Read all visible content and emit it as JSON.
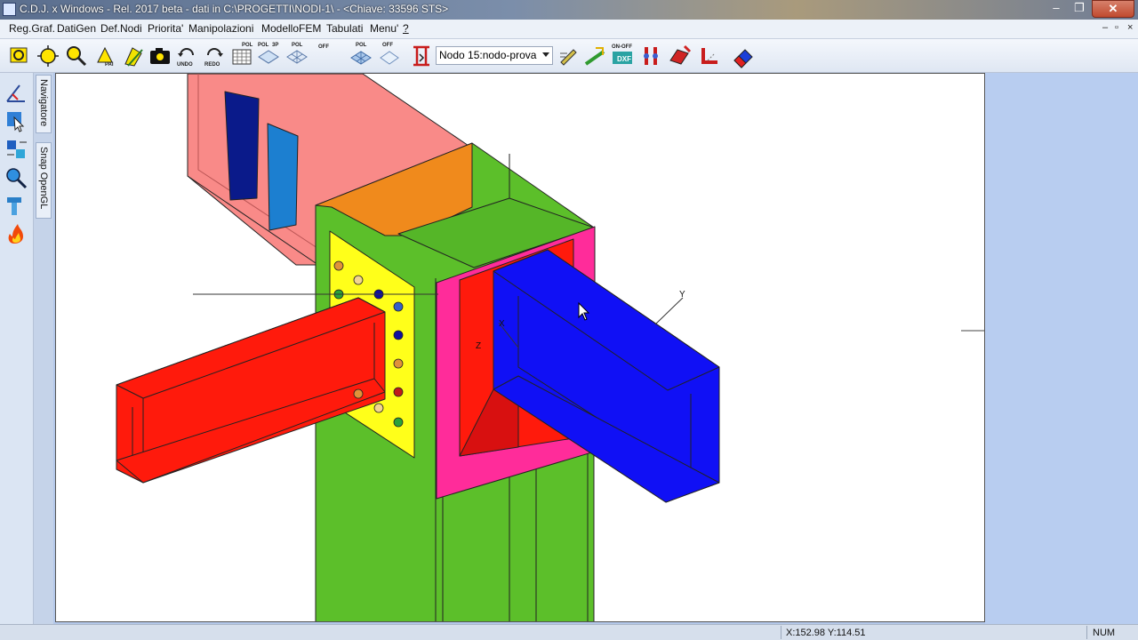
{
  "window": {
    "title": "C.D.J. x Windows - Rel. 2017 beta - dati in C:\\PROGETTI\\NODI-1\\ - <Chiave: 33596 STS>",
    "minimize_glyph": "‒",
    "maximize_glyph": "❐",
    "close_glyph": "✕"
  },
  "menu": {
    "items": [
      "Reg.Graf.",
      "DatiGen",
      "Def.Nodi",
      "Priorita'",
      "Manipolazioni",
      "ModelloFEM",
      "Tabulati",
      "Menu'",
      "?"
    ],
    "mdi_controls": [
      "–",
      "▫",
      "×"
    ]
  },
  "toolbar": {
    "undo_label": "UNDO",
    "redo_label": "REDO",
    "pai_label": "PAI",
    "pol_label": "POL",
    "pol3p_label": "3P",
    "off_label": "OFF",
    "on_off_label": "ON-OFF",
    "dxf_label": "DXF",
    "node_select_value": "Nodo 15:nodo-prova"
  },
  "side_tabs": [
    "Navigatore",
    "Snap OpenGL"
  ],
  "model_labels": {
    "axis_y": "Y",
    "axis_x": "X",
    "axis_z": "Z"
  },
  "statusbar": {
    "coords": "X:152.98  Y:114.51",
    "numlock": "NUM"
  },
  "colors": {
    "column": "#5cbf2a",
    "column_top": "#f08a1c",
    "beam_left": "#ff1a0c",
    "beam_right": "#1010f5",
    "endplate_left": "#ffff1a",
    "endplate_right": "#ff2c9a",
    "background_beam": "#f98a88",
    "stiffener_dark": "#0a1a8a",
    "stiffener_light": "#1c7fd0"
  }
}
